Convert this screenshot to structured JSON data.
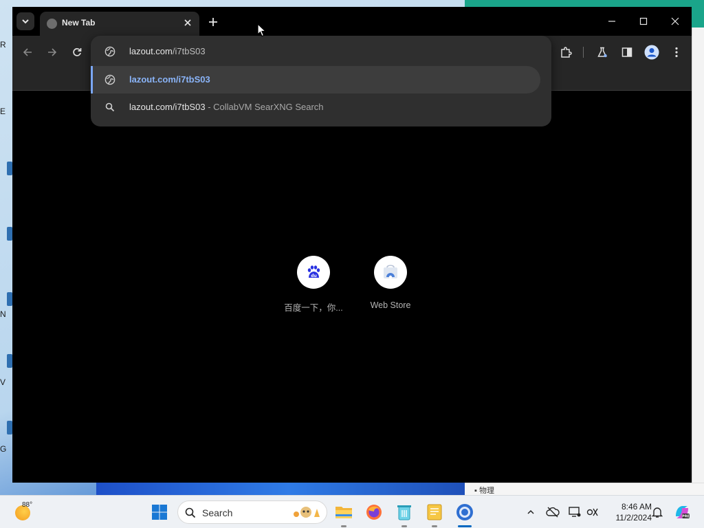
{
  "browser": {
    "tab": {
      "title": "New Tab",
      "favicon_icon": "globe-icon",
      "close_icon": "close-icon"
    },
    "new_tab_icon": "plus-icon",
    "window_controls": [
      "minimize-icon",
      "maximize-icon",
      "close-icon"
    ],
    "toolbar_icons": [
      "back-arrow-icon",
      "forward-arrow-icon",
      "reload-icon",
      "extensions-icon",
      "labs-flask-icon",
      "side-panel-icon",
      "profile-avatar-icon",
      "more-vert-icon"
    ],
    "omnibox": {
      "input_host": "lazout.com",
      "input_path": "/i7tbS03",
      "suggestions": [
        {
          "icon": "globe-icon",
          "text": "lazout.com/i7tbS03",
          "separator": "",
          "description": "",
          "selected": true
        },
        {
          "icon": "search-icon",
          "text": "lazout.com/i7tbS03",
          "separator": " - ",
          "description": "CollabVM SearXNG Search",
          "selected": false
        }
      ]
    },
    "shortcuts": [
      {
        "label": "百度一下，你...",
        "icon": "baidu-paw-icon"
      },
      {
        "label": "Web Store",
        "icon": "web-store-icon"
      }
    ],
    "accent_color": "#8ab4f8"
  },
  "desktop": {
    "labels": [
      "R",
      "E",
      "N",
      "V",
      "G"
    ],
    "bg_window_bottom_text": "▪ 物理"
  },
  "taskbar": {
    "weather_temp": "88°",
    "search_placeholder": "Search",
    "apps": [
      "file-explorer-icon",
      "firefox-icon",
      "recycle-bin-icon",
      "notepad-icon",
      "chrome-icon"
    ],
    "time": "8:46 AM",
    "date": "11/2/2024",
    "tray_icons": [
      "chevron-up-icon",
      "cloud-offline-icon",
      "display-icon",
      "network-icon",
      "bell-icon",
      "copilot-icon"
    ]
  }
}
